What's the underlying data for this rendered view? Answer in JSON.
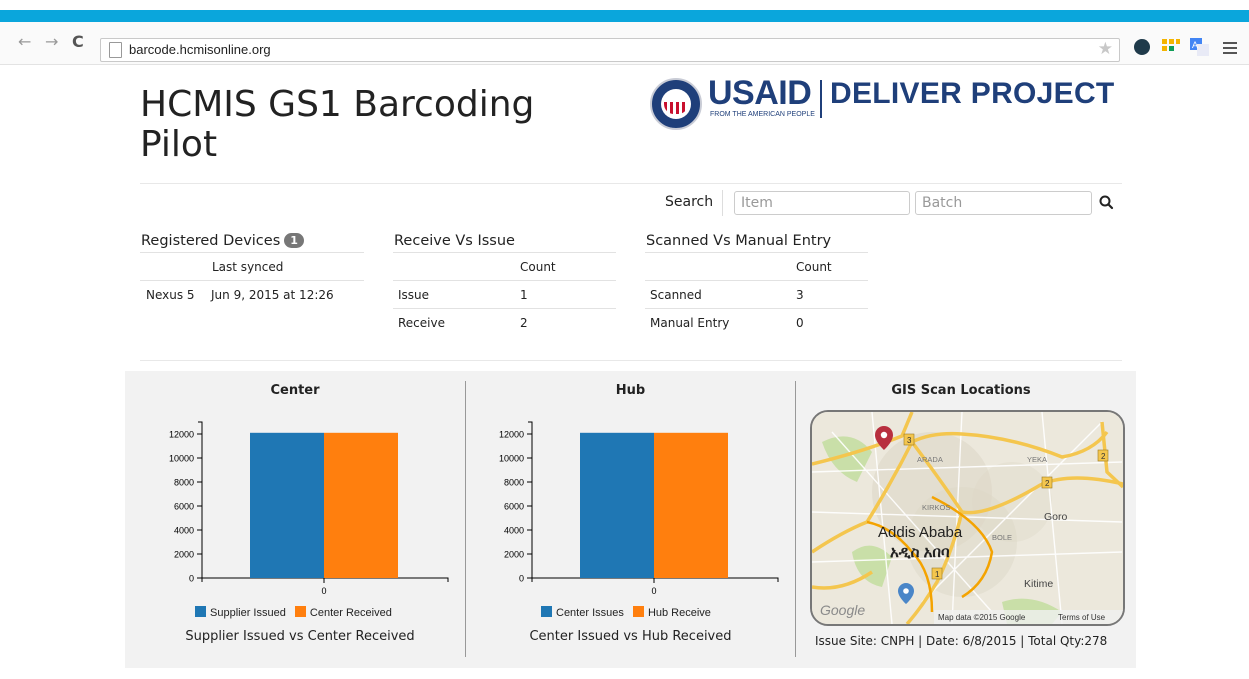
{
  "browser": {
    "url": "barcode.hcmisonline.org"
  },
  "page": {
    "title": "HCMIS GS1 Barcoding Pilot"
  },
  "logo": {
    "usaid": "USAID",
    "usaid_tagline": "FROM THE AMERICAN PEOPLE",
    "project": "DELIVER PROJECT"
  },
  "search": {
    "label": "Search",
    "item_placeholder": "Item",
    "batch_placeholder": "Batch"
  },
  "registered_devices": {
    "title": "Registered Devices",
    "count": "1",
    "col_last_synced": "Last synced",
    "rows": [
      {
        "device": "Nexus 5",
        "last_synced": "Jun 9, 2015 at 12:26"
      }
    ]
  },
  "receive_vs_issue": {
    "title": "Receive Vs Issue",
    "col_count": "Count",
    "rows": [
      {
        "label": "Issue",
        "count": "1"
      },
      {
        "label": "Receive",
        "count": "2"
      }
    ]
  },
  "scanned_vs_manual": {
    "title": "Scanned Vs Manual Entry",
    "col_count": "Count",
    "rows": [
      {
        "label": "Scanned",
        "count": "3"
      },
      {
        "label": "Manual Entry",
        "count": "0"
      }
    ]
  },
  "chart_data": [
    {
      "type": "bar",
      "title": "Center",
      "subtitle": "Supplier Issued vs Center Received",
      "categories": [
        "0"
      ],
      "series": [
        {
          "name": "Supplier Issued",
          "values": [
            12100
          ],
          "color": "#1f77b4"
        },
        {
          "name": "Center Received",
          "values": [
            12100
          ],
          "color": "#ff7f0e"
        }
      ],
      "yticks": [
        "0",
        "2000",
        "4000",
        "6000",
        "8000",
        "10000",
        "12000"
      ],
      "ylim": [
        0,
        13000
      ],
      "legend": "bottom"
    },
    {
      "type": "bar",
      "title": "Hub",
      "subtitle": "Center Issued vs Hub Received",
      "categories": [
        "0"
      ],
      "series": [
        {
          "name": "Center Issues",
          "values": [
            12100
          ],
          "color": "#1f77b4"
        },
        {
          "name": "Hub Receive",
          "values": [
            12100
          ],
          "color": "#ff7f0e"
        }
      ],
      "yticks": [
        "0",
        "2000",
        "4000",
        "6000",
        "8000",
        "10000",
        "12000"
      ],
      "ylim": [
        0,
        13000
      ],
      "legend": "bottom"
    }
  ],
  "gis": {
    "title": "GIS Scan Locations",
    "map_city": "Addis Ababa",
    "map_city_local": "አዲስ አበባ",
    "map_labels": [
      "ARADA",
      "YEKA",
      "KIRKOS",
      "Goro",
      "BOLE",
      "Kitime"
    ],
    "road_markers": [
      "3",
      "2",
      "2",
      "1"
    ],
    "map_attribution": "Map data ©2015 Google",
    "map_terms": "Terms of Use",
    "google": "Google",
    "footer": "Issue Site: CNPH | Date: 6/8/2015 | Total Qty:278"
  }
}
